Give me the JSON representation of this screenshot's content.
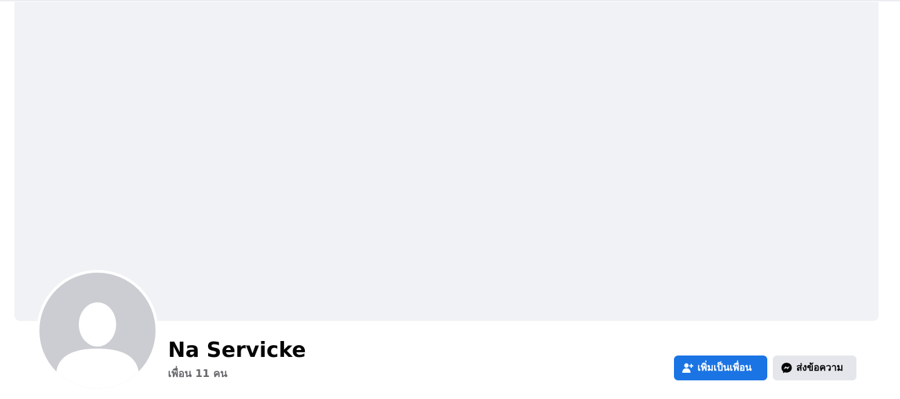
{
  "profile": {
    "name": "Na Servicke",
    "friends_text": "เพื่อน 11 คน"
  },
  "actions": {
    "add_friend_label": "เพิ่มเป็นเพื่อน",
    "add_friend_icon": "person-add-icon",
    "message_label": "ส่งข้อความ",
    "message_icon": "messenger-icon"
  },
  "colors": {
    "primary": "#1b74e4",
    "secondary_button": "#e4e6eb",
    "cover_placeholder": "#f0f2f5",
    "avatar_placeholder": "#cbcdd2",
    "text_primary": "#050505",
    "text_secondary": "#65676b"
  }
}
